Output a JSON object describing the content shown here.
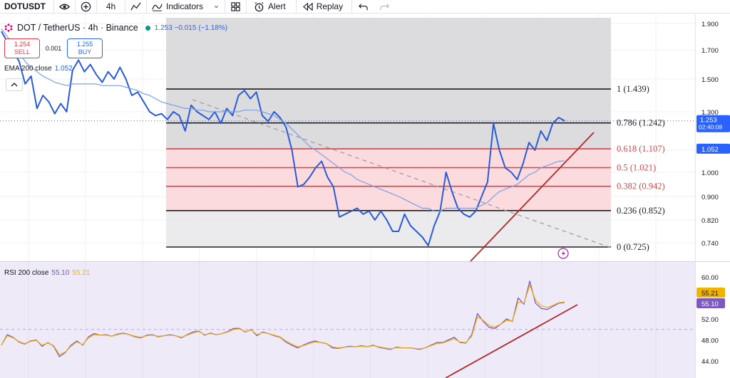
{
  "toolbar": {
    "symbol": "DOTUSDT",
    "interval": "4h",
    "indicators_label": "Indicators",
    "alert_label": "Alert",
    "replay_label": "Replay",
    "icons": [
      "eye-icon",
      "plus-circle-icon",
      "line-tool-icon",
      "indicators-icon",
      "chevron-down-icon",
      "templates-icon",
      "alert-icon",
      "replay-icon",
      "undo-icon",
      "redo-icon"
    ]
  },
  "header": {
    "title": "DOT / TetherUS · 4h · Binance",
    "quote": "1.253  −0.015 (−1.18%)",
    "sell_price": "1.254",
    "sell_label": "SELL",
    "spread": "0.001",
    "buy_price": "1.255",
    "buy_label": "BUY",
    "ema_label": "EMA 200 close",
    "ema_value": "1.052",
    "rsi_label": "RSI 200 close",
    "rsi_value_1": "55.10",
    "rsi_value_2": "55.21"
  },
  "colors": {
    "price_line": "#2a5bd7",
    "ema_line": "#7a9ee6",
    "fib_black": "#1f1f1f",
    "fib_red": "#d64545",
    "fib_fill_red": "#fbd5d8",
    "fib_fill_gray": "#d8d8da",
    "trendline": "#b02a2a",
    "rsi_line": "#7e57c2",
    "rsi_ma": "#f0b400",
    "rsi_bg": "#efeaf8",
    "current_price_badge": "#2962ff",
    "ema_badge": "#2962ff"
  },
  "chart_data": [
    {
      "type": "line",
      "title": "DOT / TetherUS · 4h · Binance",
      "ylim": [
        0.7,
        1.95
      ],
      "y_ticks": [
        "1.900",
        "1.700",
        "1.500",
        "1.300",
        "1.100",
        "1.000",
        "0.900",
        "0.820",
        "0.740"
      ],
      "y_tick_values": [
        1.9,
        1.7,
        1.5,
        1.3,
        1.1,
        1.0,
        0.9,
        0.82,
        0.74
      ],
      "current_price": {
        "value": 1.253,
        "label": "1.253",
        "countdown": "02:40:08"
      },
      "ema_badge": {
        "value": 1.052,
        "label": "1.052"
      },
      "series": [
        {
          "name": "DOT / TetherUS",
          "values": [
            1.84,
            1.76,
            1.69,
            1.62,
            1.47,
            1.52,
            1.32,
            1.4,
            1.36,
            1.29,
            1.35,
            1.3,
            1.56,
            1.63,
            1.55,
            1.6,
            1.53,
            1.48,
            1.55,
            1.5,
            1.58,
            1.5,
            1.4,
            1.42,
            1.36,
            1.3,
            1.28,
            1.29,
            1.26,
            1.3,
            1.28,
            1.2,
            1.34,
            1.3,
            1.28,
            1.26,
            1.3,
            1.24,
            1.32,
            1.28,
            1.4,
            1.43,
            1.38,
            1.42,
            1.28,
            1.25,
            1.3,
            1.27,
            1.22,
            1.1,
            0.94,
            0.95,
            0.98,
            1.02,
            1.05,
            0.98,
            0.94,
            0.83,
            0.84,
            0.85,
            0.86,
            0.84,
            0.85,
            0.82,
            0.85,
            0.82,
            0.78,
            0.78,
            0.84,
            0.8,
            0.78,
            0.76,
            0.73,
            0.8,
            0.85,
            1.0,
            0.92,
            0.86,
            0.84,
            0.83,
            0.85,
            0.9,
            0.96,
            1.24,
            1.1,
            1.02,
            1.0,
            0.97,
            1.04,
            1.14,
            1.1,
            1.2,
            1.15,
            1.24,
            1.27,
            1.253
          ]
        },
        {
          "name": "EMA 200 close",
          "values": [
            1.86,
            1.8,
            1.74,
            1.68,
            1.62,
            1.58,
            1.55,
            1.52,
            1.5,
            1.48,
            1.47,
            1.46,
            1.47,
            1.47,
            1.47,
            1.47,
            1.47,
            1.46,
            1.46,
            1.46,
            1.46,
            1.45,
            1.44,
            1.43,
            1.41,
            1.4,
            1.38,
            1.36,
            1.35,
            1.34,
            1.33,
            1.32,
            1.32,
            1.31,
            1.31,
            1.3,
            1.3,
            1.3,
            1.3,
            1.3,
            1.3,
            1.31,
            1.31,
            1.31,
            1.3,
            1.29,
            1.28,
            1.26,
            1.24,
            1.21,
            1.18,
            1.15,
            1.12,
            1.1,
            1.08,
            1.06,
            1.04,
            1.02,
            1.0,
            0.99,
            0.97,
            0.96,
            0.95,
            0.94,
            0.93,
            0.92,
            0.91,
            0.9,
            0.89,
            0.88,
            0.87,
            0.86,
            0.86,
            0.85,
            0.85,
            0.86,
            0.86,
            0.86,
            0.86,
            0.86,
            0.86,
            0.87,
            0.88,
            0.9,
            0.92,
            0.93,
            0.94,
            0.95,
            0.97,
            0.99,
            1.0,
            1.02,
            1.03,
            1.04,
            1.05,
            1.052
          ]
        }
      ]
    },
    {
      "type": "line",
      "title": "RSI 200 close",
      "ylim": [
        42,
        62
      ],
      "y_ticks": [
        "60.00",
        "56.00",
        "52.00",
        "48.00",
        "44.00"
      ],
      "y_tick_values": [
        60,
        56,
        52,
        48,
        44
      ],
      "badges": [
        {
          "value": 55.21,
          "label": "55.21"
        },
        {
          "value": 55.1,
          "label": "55.10"
        }
      ],
      "series": [
        {
          "name": "RSI 200 close",
          "values": [
            47.0,
            49.0,
            48.5,
            47.6,
            47.2,
            47.8,
            48.0,
            46.8,
            47.5,
            46.8,
            44.8,
            45.6,
            47.0,
            47.8,
            47.0,
            48.6,
            49.2,
            48.9,
            49.0,
            48.7,
            49.1,
            49.3,
            49.0,
            48.6,
            48.4,
            48.9,
            49.0,
            48.6,
            48.8,
            49.0,
            48.8,
            48.4,
            49.0,
            49.5,
            49.7,
            48.9,
            49.3,
            49.0,
            49.2,
            49.6,
            50.2,
            50.2,
            49.5,
            50.0,
            48.8,
            49.5,
            49.2,
            48.8,
            48.5,
            47.6,
            47.0,
            46.5,
            47.0,
            47.5,
            47.8,
            47.5,
            47.3,
            46.5,
            46.4,
            46.6,
            46.8,
            46.7,
            46.9,
            46.7,
            47.0,
            46.6,
            46.4,
            46.2,
            46.6,
            46.5,
            46.5,
            46.4,
            46.2,
            46.5,
            47.0,
            47.5,
            47.5,
            48.0,
            48.5,
            47.5,
            47.4,
            49.0,
            53.0,
            51.5,
            50.4,
            50.2,
            51.0,
            52.0,
            51.5,
            56.0,
            54.8,
            59.2,
            55.0,
            54.0,
            53.8,
            54.4,
            55.0,
            55.1
          ]
        },
        {
          "name": "RSI MA",
          "values": [
            47.0,
            48.8,
            48.4,
            47.7,
            47.3,
            47.7,
            47.9,
            47.0,
            47.4,
            46.9,
            45.2,
            45.7,
            46.8,
            47.6,
            47.1,
            48.4,
            49.0,
            48.9,
            48.9,
            48.7,
            49.0,
            49.2,
            49.0,
            48.7,
            48.5,
            48.8,
            48.9,
            48.7,
            48.8,
            48.9,
            48.8,
            48.5,
            48.9,
            49.3,
            49.6,
            49.0,
            49.2,
            49.0,
            49.2,
            49.5,
            50.0,
            50.1,
            49.6,
            49.9,
            49.0,
            49.4,
            49.2,
            48.9,
            48.6,
            47.8,
            47.2,
            46.7,
            46.9,
            47.3,
            47.6,
            47.5,
            47.3,
            46.7,
            46.5,
            46.6,
            46.7,
            46.7,
            46.8,
            46.7,
            46.9,
            46.7,
            46.5,
            46.3,
            46.5,
            46.5,
            46.5,
            46.4,
            46.3,
            46.5,
            46.9,
            47.3,
            47.4,
            47.8,
            48.2,
            47.6,
            47.5,
            48.7,
            52.4,
            51.7,
            50.8,
            50.5,
            51.0,
            51.7,
            51.6,
            55.2,
            55.0,
            58.4,
            55.6,
            54.5,
            54.2,
            54.6,
            55.1,
            55.21
          ]
        }
      ]
    }
  ],
  "fibonacci": {
    "levels": [
      {
        "ratio": 1,
        "value": 1.439,
        "label": "1 (1.439)",
        "color": "#1f1f1f"
      },
      {
        "ratio": 0.786,
        "value": 1.242,
        "label": "0.786 (1.242)",
        "color": "#1f1f1f"
      },
      {
        "ratio": 0.618,
        "value": 1.107,
        "label": "0.618 (1.107)",
        "color": "#d64545"
      },
      {
        "ratio": 0.5,
        "value": 1.021,
        "label": "0.5 (1.021)",
        "color": "#d64545"
      },
      {
        "ratio": 0.382,
        "value": 0.942,
        "label": "0.382 (0.942)",
        "color": "#d64545"
      },
      {
        "ratio": 0.236,
        "value": 0.852,
        "label": "0.236 (0.852)",
        "color": "#1f1f1f"
      },
      {
        "ratio": 0,
        "value": 0.725,
        "label": "0 (0.725)",
        "color": "#1f1f1f"
      }
    ]
  }
}
